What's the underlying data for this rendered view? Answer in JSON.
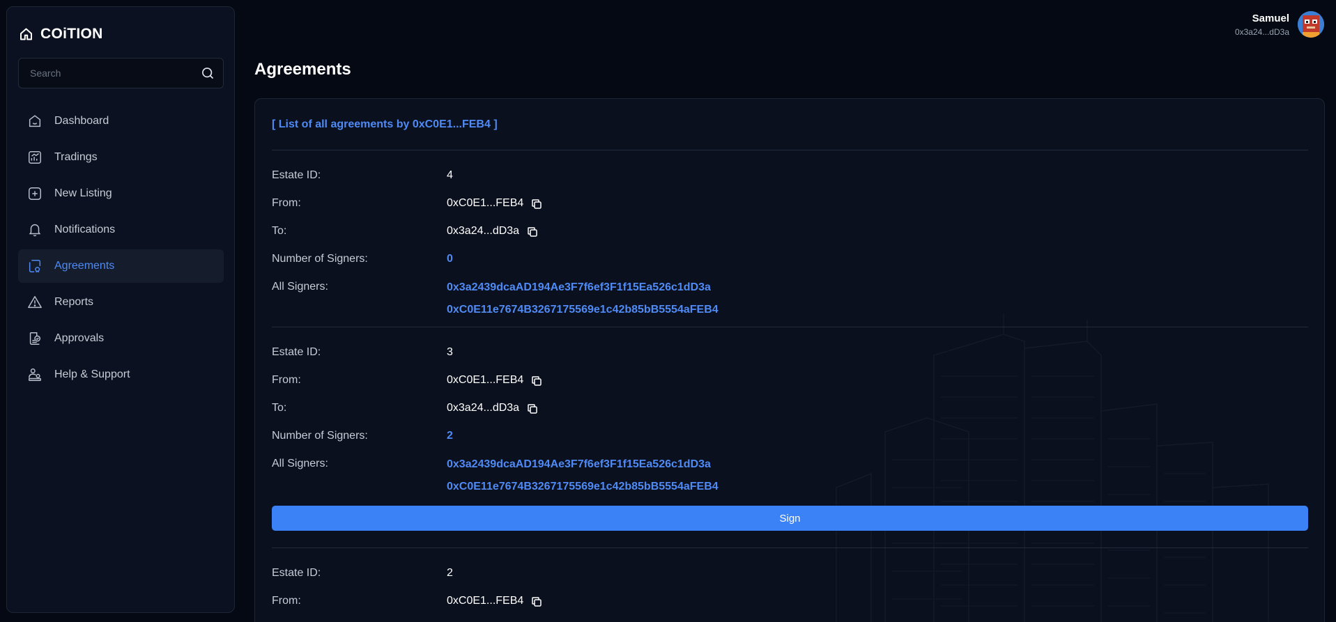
{
  "brand": {
    "name": "COiTION"
  },
  "search": {
    "placeholder": "Search"
  },
  "nav": [
    {
      "label": "Dashboard",
      "icon": "dashboard-icon",
      "active": false
    },
    {
      "label": "Tradings",
      "icon": "tradings-icon",
      "active": false
    },
    {
      "label": "New Listing",
      "icon": "plus-square-icon",
      "active": false
    },
    {
      "label": "Notifications",
      "icon": "bell-icon",
      "active": false
    },
    {
      "label": "Agreements",
      "icon": "agreement-icon",
      "active": true
    },
    {
      "label": "Reports",
      "icon": "warning-icon",
      "active": false
    },
    {
      "label": "Approvals",
      "icon": "approval-icon",
      "active": false
    },
    {
      "label": "Help & Support",
      "icon": "support-icon",
      "active": false
    }
  ],
  "user": {
    "name": "Samuel",
    "address": "0x3a24...dD3a"
  },
  "page": {
    "title": "Agreements"
  },
  "list": {
    "header": "[ List of all agreements by 0xC0E1...FEB4 ]"
  },
  "labels": {
    "estate_id": "Estate ID:",
    "from": "From:",
    "to": "To:",
    "num_signers": "Number of Signers:",
    "all_signers": "All Signers:"
  },
  "agreements": [
    {
      "estate_id": "4",
      "from": "0xC0E1...FEB4",
      "to": "0x3a24...dD3a",
      "num_signers": "0",
      "signers": [
        "0x3a2439dcaAD194Ae3F7f6ef3F1f15Ea526c1dD3a",
        "0xC0E11e7674B3267175569e1c42b85bB5554aFEB4"
      ]
    },
    {
      "estate_id": "3",
      "from": "0xC0E1...FEB4",
      "to": "0x3a24...dD3a",
      "num_signers": "2",
      "signers": [
        "0x3a2439dcaAD194Ae3F7f6ef3F1f15Ea526c1dD3a",
        "0xC0E11e7674B3267175569e1c42b85bB5554aFEB4"
      ],
      "sign_label": "Sign"
    },
    {
      "estate_id": "2",
      "from": "0xC0E1...FEB4"
    }
  ],
  "colors": {
    "accent": "#3b82f6",
    "link": "#4f8af5",
    "background": "#050913",
    "panel": "#0b1120"
  }
}
